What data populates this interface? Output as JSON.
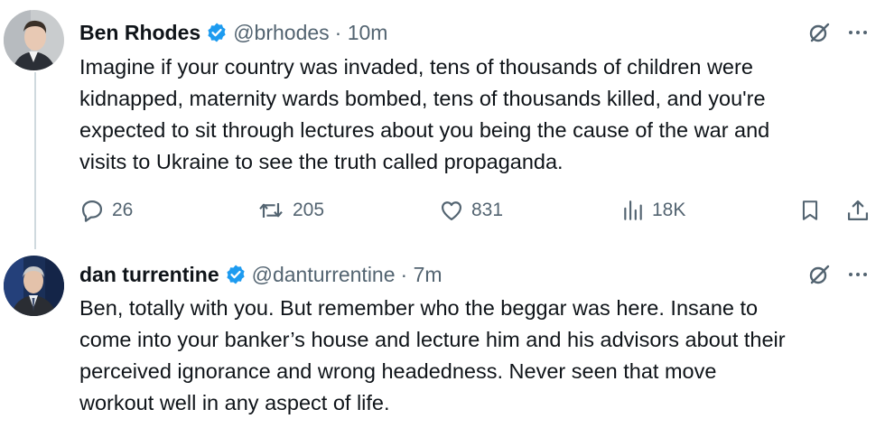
{
  "tweets": [
    {
      "author": "Ben Rhodes",
      "handle": "@brhodes",
      "time": "· 10m",
      "text_lines": [
        "Imagine if your country was invaded, tens of thousands of children were",
        "kidnapped, maternity wards bombed, tens of thousands killed, and you're",
        "expected to sit through lectures about you being the cause of the war and",
        "visits to Ukraine to see the truth called propaganda."
      ],
      "replies": "26",
      "reposts": "205",
      "likes": "831",
      "views": "18K"
    },
    {
      "author": "dan turrentine",
      "handle": "@danturrentine",
      "time": "· 7m",
      "text_lines": [
        "Ben, totally with you. But remember who the beggar was here.  Insane to",
        "come into your banker’s house and lecture him and his advisors about their",
        "perceived ignorance and wrong headedness.  Never seen that move",
        "workout well in any aspect of life."
      ]
    }
  ],
  "colors": {
    "text": "#0f1419",
    "secondary": "#536471",
    "verified": "#1d9bf0",
    "thread_line": "#cfd9de"
  },
  "icons": [
    "grok-icon",
    "more-icon",
    "reply-icon",
    "repost-icon",
    "like-icon",
    "views-icon",
    "bookmark-icon",
    "share-icon",
    "verified-badge-icon"
  ]
}
